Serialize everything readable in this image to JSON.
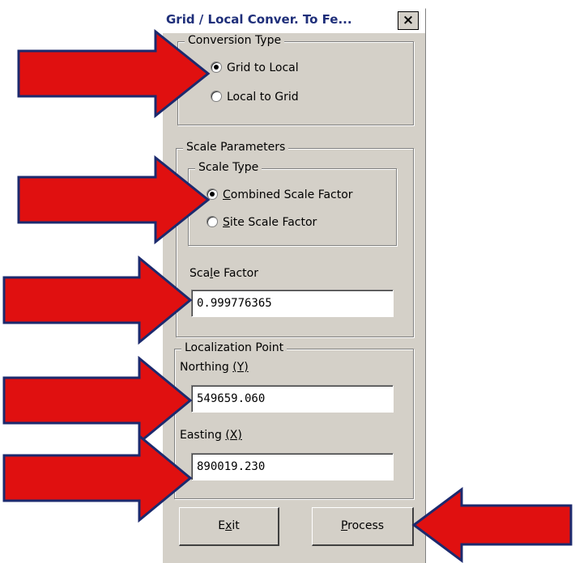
{
  "window": {
    "title": "Grid / Local Conver. To Fe...",
    "close_glyph": "×"
  },
  "conversion_type": {
    "legend": "Conversion Type",
    "options": [
      {
        "label": "Grid to Local",
        "checked": true
      },
      {
        "label": "Local to Grid",
        "checked": false
      }
    ]
  },
  "scale_parameters": {
    "legend": "Scale Parameters",
    "scale_type": {
      "legend": "Scale Type",
      "options": [
        {
          "label_pre": "",
          "mnemonic": "C",
          "label_post": "ombined Scale Factor",
          "checked": true
        },
        {
          "label_pre": "",
          "mnemonic": "S",
          "label_post": "ite Scale Factor",
          "checked": false
        }
      ]
    },
    "scale_factor": {
      "label_pre": "Sca",
      "mnemonic": "l",
      "label_post": "e Factor",
      "value": "0.999776365"
    }
  },
  "localization_point": {
    "legend": "Localization Point",
    "northing": {
      "label_pre": "Northing ",
      "mnemonic": "(Y)",
      "value": "549659.060"
    },
    "easting": {
      "label_pre": "Easting ",
      "mnemonic": "(X)",
      "value": "890019.230"
    }
  },
  "buttons": {
    "exit": {
      "label_pre": "E",
      "mnemonic": "x",
      "label_post": "it"
    },
    "process": {
      "label_pre": "",
      "mnemonic": "P",
      "label_post": "rocess"
    }
  },
  "annotation": {
    "arrow_fill": "#e01010",
    "arrow_stroke": "#1c2a6e"
  }
}
